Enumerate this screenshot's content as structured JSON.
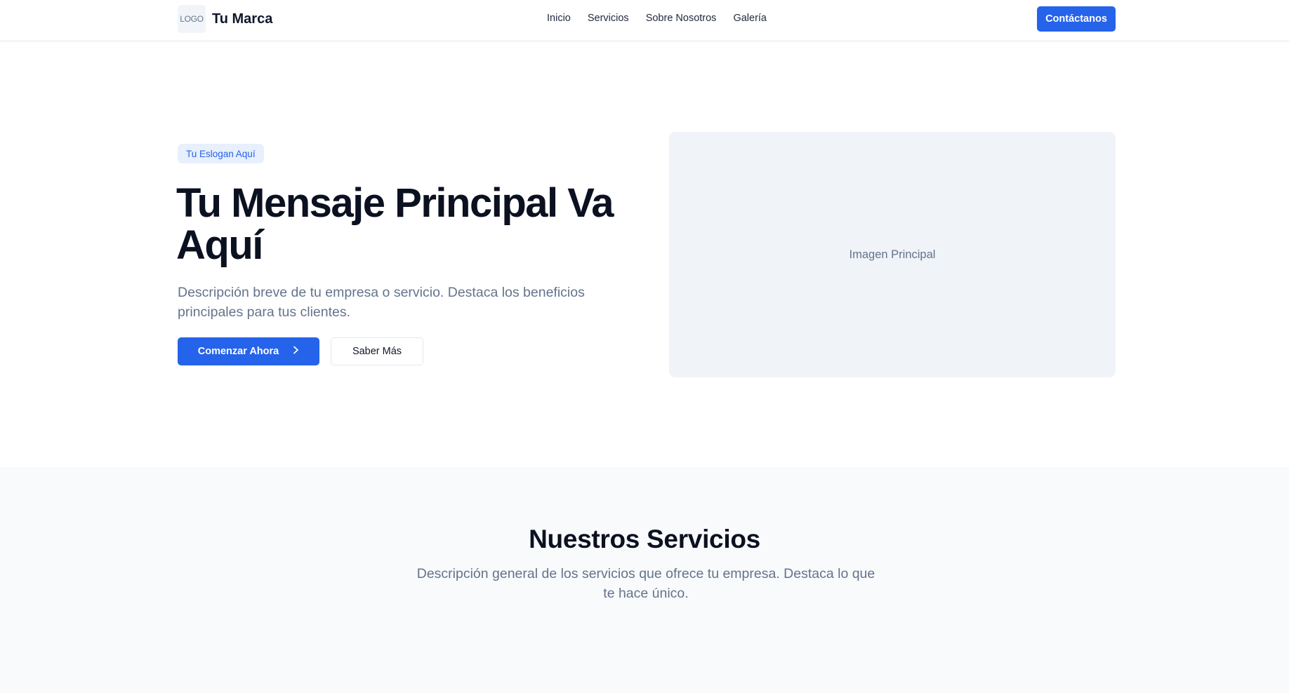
{
  "header": {
    "logo_text": "LOGO",
    "brand_name": "Tu Marca",
    "nav": [
      {
        "label": "Inicio"
      },
      {
        "label": "Servicios"
      },
      {
        "label": "Sobre Nosotros"
      },
      {
        "label": "Galería"
      }
    ],
    "cta_label": "Contáctanos"
  },
  "hero": {
    "badge": "Tu Eslogan Aquí",
    "title": "Tu Mensaje Principal Va Aquí",
    "description": "Descripción breve de tu empresa o servicio. Destaca los beneficios principales para tus clientes.",
    "primary_button": "Comenzar Ahora",
    "secondary_button": "Saber Más",
    "image_placeholder": "Imagen Principal"
  },
  "services": {
    "title": "Nuestros Servicios",
    "description": "Descripción general de los servicios que ofrece tu empresa. Destaca lo que te hace único."
  },
  "colors": {
    "accent": "#2563eb",
    "badge_bg": "#e8effd",
    "muted_text": "#64748b",
    "section_bg": "#f8fafc"
  },
  "icons": {
    "primary_button_icon": "chevron-right-icon"
  }
}
